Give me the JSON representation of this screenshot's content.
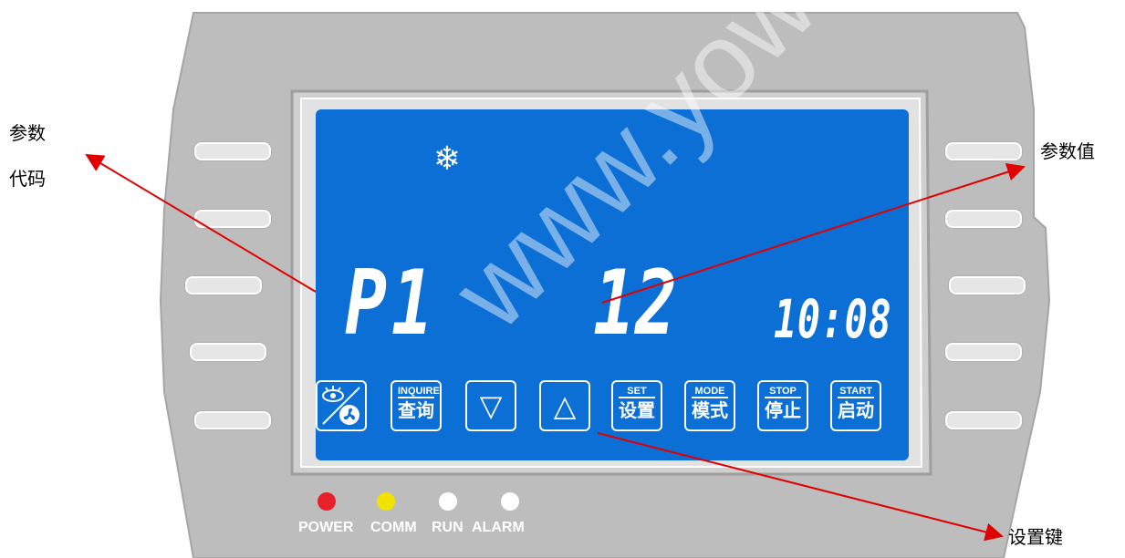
{
  "display": {
    "param_code": "P1",
    "param_value": "12",
    "clock": "10:08",
    "mode_icon": "snowflake-icon"
  },
  "buttons": [
    {
      "name": "view-fan",
      "icon": "eye-fan-icon"
    },
    {
      "name": "inquire",
      "en": "INQUIRE",
      "zh": "查询"
    },
    {
      "name": "down",
      "icon": "down-triangle-icon",
      "glyph": "▽"
    },
    {
      "name": "up",
      "icon": "up-triangle-icon",
      "glyph": "△"
    },
    {
      "name": "set",
      "en": "SET",
      "zh": "设置"
    },
    {
      "name": "mode",
      "en": "MODE",
      "zh": "模式"
    },
    {
      "name": "stop",
      "en": "STOP",
      "zh": "停止"
    },
    {
      "name": "start",
      "en": "START",
      "zh": "启动"
    }
  ],
  "leds": [
    {
      "label": "POWER",
      "color": "#e8202a"
    },
    {
      "label": "COMM",
      "color": "#f2e200"
    },
    {
      "label": "RUN",
      "color": "#ffffff"
    },
    {
      "label": "ALARM",
      "color": "#ffffff"
    }
  ],
  "annotations": {
    "param_code_line1": "参数",
    "param_code_line2": "代码",
    "param_value": "参数值",
    "set_key": "设置键"
  },
  "watermark": "www.yowder.com",
  "colors": {
    "lcd": "#0b6fd6",
    "panel": "#b9b9b9",
    "arrow": "#e00000"
  }
}
